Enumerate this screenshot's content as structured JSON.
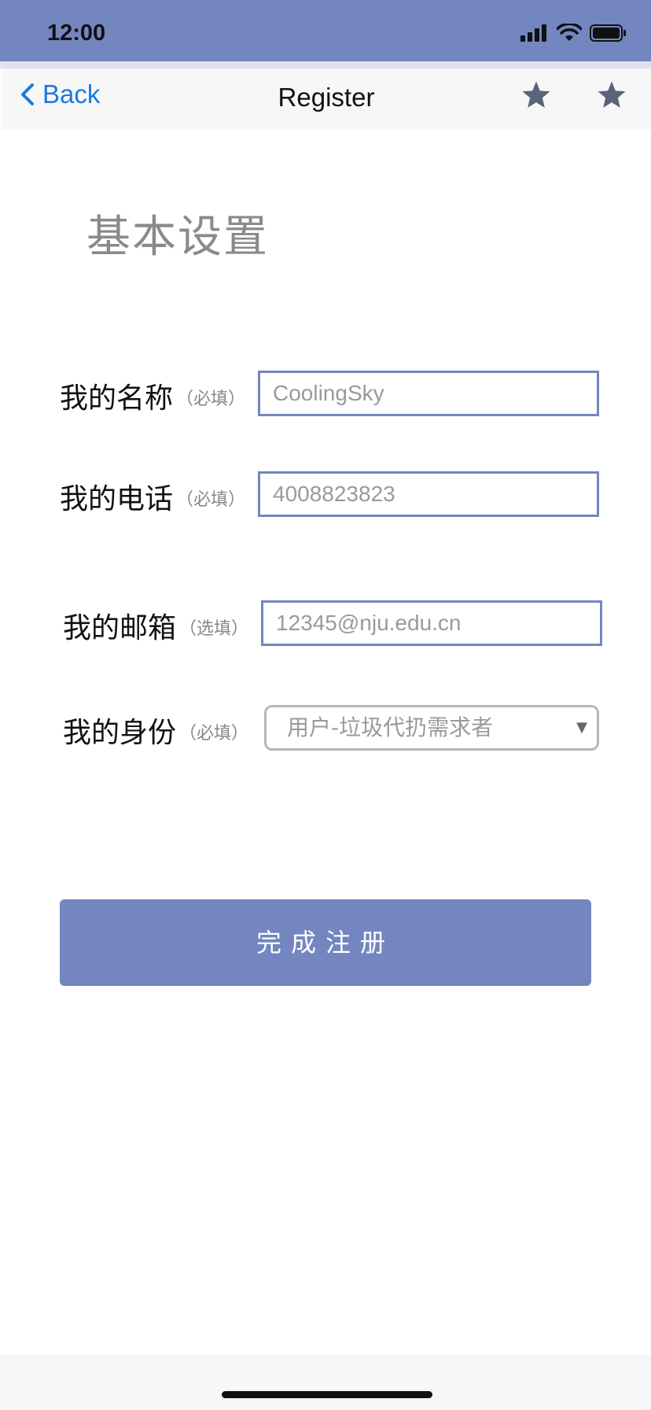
{
  "status_bar": {
    "time": "12:00"
  },
  "nav": {
    "back_label": "Back",
    "title": "Register"
  },
  "section_title": "基本设置",
  "form": {
    "name": {
      "label": "我的名称",
      "note": "（必填）",
      "placeholder": "CoolingSky"
    },
    "phone": {
      "label": "我的电话",
      "note": "（必填）",
      "placeholder": "4008823823"
    },
    "email": {
      "label": "我的邮箱",
      "note": "（选填）",
      "placeholder": "12345@nju.edu.cn"
    },
    "identity": {
      "label": "我的身份",
      "note": "（必填）",
      "selected": "用户-垃圾代扔需求者"
    }
  },
  "submit_label": "完成注册",
  "colors": {
    "accent": "#7386c0",
    "link": "#1a7ae0",
    "star": "#586478"
  },
  "icons": {
    "back": "chevron-left-icon",
    "star": "star-icon",
    "signal": "signal-icon",
    "wifi": "wifi-icon",
    "battery": "battery-icon",
    "dropdown": "dropdown-caret-icon"
  }
}
